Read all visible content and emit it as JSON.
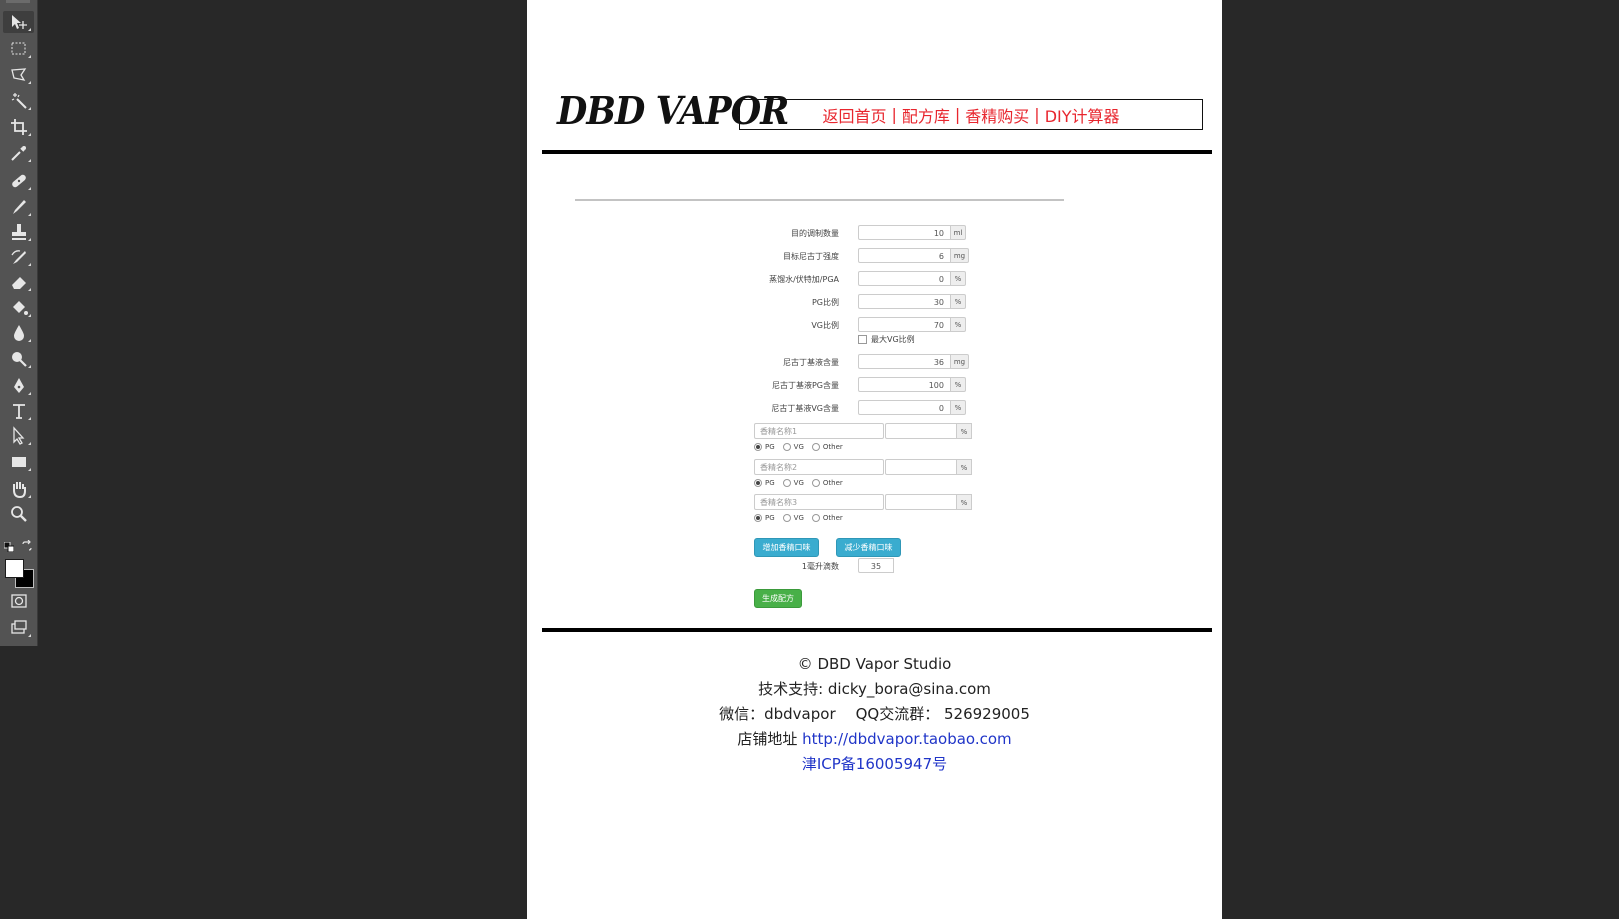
{
  "toolbar": {
    "tools": [
      {
        "icon": "move-icon"
      },
      {
        "icon": "rectangular-marquee-icon"
      },
      {
        "icon": "polygonal-lasso-icon"
      },
      {
        "icon": "magic-wand-icon"
      },
      {
        "icon": "crop-icon"
      },
      {
        "icon": "eyedropper-icon"
      },
      {
        "icon": "healing-brush-icon"
      },
      {
        "icon": "brush-icon"
      },
      {
        "icon": "clone-stamp-icon"
      },
      {
        "icon": "history-brush-icon"
      },
      {
        "icon": "eraser-icon"
      },
      {
        "icon": "paint-bucket-icon"
      },
      {
        "icon": "blur-icon"
      },
      {
        "icon": "dodge-icon"
      },
      {
        "icon": "pen-icon"
      },
      {
        "icon": "type-icon"
      },
      {
        "icon": "path-selection-icon"
      },
      {
        "icon": "rectangle-shape-icon"
      },
      {
        "icon": "hand-icon"
      },
      {
        "icon": "zoom-icon"
      }
    ],
    "foreground_color": "#ffffff",
    "background_color": "#000000"
  },
  "page": {
    "logo": "DBD VAPOR",
    "nav": [
      "返回首页",
      "配方库",
      "香精购买",
      "DIY计算器"
    ],
    "nav_separator": "|",
    "accent_color": "#e8262e"
  },
  "form": {
    "fields": [
      {
        "label": "目的调制数量",
        "value": "10",
        "unit": "ml"
      },
      {
        "label": "目标尼古丁强度",
        "value": "6",
        "unit": "mg"
      },
      {
        "label": "蒸馏水/伏特加/PGA",
        "value": "0",
        "unit": "%"
      },
      {
        "label": "PG比例",
        "value": "30",
        "unit": "%"
      },
      {
        "label": "VG比例",
        "value": "70",
        "unit": "%"
      }
    ],
    "max_vg_label": "最大VG比例",
    "nic_fields": [
      {
        "label": "尼古丁基液含量",
        "value": "36",
        "unit": "mg"
      },
      {
        "label": "尼古丁基液PG含量",
        "value": "100",
        "unit": "%"
      },
      {
        "label": "尼古丁基液VG含量",
        "value": "0",
        "unit": "%"
      }
    ],
    "flavors": [
      {
        "placeholder": "香精名称1",
        "unit": "%"
      },
      {
        "placeholder": "香精名称2",
        "unit": "%"
      },
      {
        "placeholder": "香精名称3",
        "unit": "%"
      }
    ],
    "radio_options": [
      "PG",
      "VG",
      "Other"
    ],
    "add_flavor_button": "增加香精口味",
    "remove_flavor_button": "减少香精口味",
    "drops_label": "1毫升滴数",
    "drops_value": "35",
    "generate_button": "生成配方"
  },
  "footer": {
    "copyright": "© DBD Vapor Studio",
    "support": "技术支持: dicky_bora@sina.com",
    "wechat": "微信：dbdvapor",
    "qq": "QQ交流群： 526929005",
    "shop_label": "店铺地址",
    "shop_link": "http://dbdvapor.taobao.com",
    "icp": "津ICP备16005947号",
    "link_color": "#2035c8"
  }
}
